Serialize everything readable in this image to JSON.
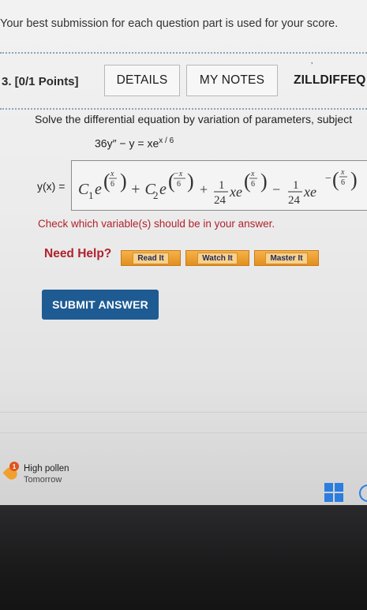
{
  "header": {
    "submission_note": "Your best submission for each question part is used for your score."
  },
  "question": {
    "number_label": "3.  [0/1 Points]",
    "tabs": [
      "DETAILS",
      "MY NOTES",
      "ZILLDIFFEQ"
    ],
    "prompt": "Solve the differential equation by variation of parameters, subject",
    "equation": {
      "lhs": "36y″ − y = xe",
      "exponent": "x / 6"
    },
    "answer_label": "y(x) =",
    "answer_value": "C₁e^(x/6) + C₂e^(−x/6) + (1/24)xe^(x/6) − (1/24)xe^(−(x/6))",
    "answer_parts": {
      "c1": "C",
      "sub1": "1",
      "plus_c2": "+ C",
      "sub2": "2",
      "plus": "+",
      "minus": "−",
      "e": "e",
      "xe": "xe",
      "one": "1",
      "twentyfour": "24",
      "x": "x",
      "neg_x": "−x",
      "six": "6",
      "neg_sign": "−"
    },
    "warning": "Check which variable(s) should be in your answer.",
    "help": {
      "label": "Need Help?",
      "buttons": [
        "Read It",
        "Watch It",
        "Master It"
      ]
    },
    "submit_label": "SUBMIT ANSWER"
  },
  "taskbar": {
    "badge": "1",
    "weather_title": "High pollen",
    "weather_subtitle": "Tomorrow"
  },
  "colors": {
    "accent_red": "#b0222c",
    "submit_blue": "#1e5b93",
    "help_orange": "#e28f1e",
    "windows_blue": "#2c7de0"
  }
}
